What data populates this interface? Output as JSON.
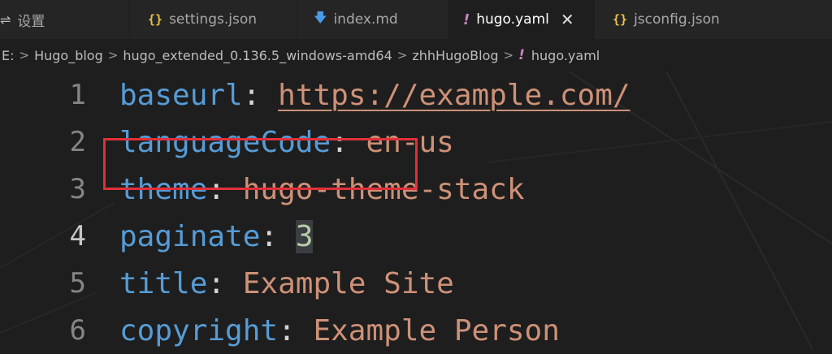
{
  "tabs": [
    {
      "label": "设置",
      "icon": "settings-icon"
    },
    {
      "label": "settings.json",
      "icon": "json-icon"
    },
    {
      "label": "index.md",
      "icon": "markdown-icon"
    },
    {
      "label": "hugo.yaml",
      "icon": "yaml-icon",
      "active": true,
      "close_glyph": "✕"
    },
    {
      "label": "jsconfig.json",
      "icon": "json-icon"
    }
  ],
  "icons": {
    "settings_glyph": "⇌",
    "json_glyph": "{}",
    "markdown_glyph": "🡇",
    "yaml_glyph": "!"
  },
  "breadcrumb": [
    "E:",
    "Hugo_blog",
    "hugo_extended_0.136.5_windows-amd64",
    "zhhHugoBlog",
    "hugo.yaml"
  ],
  "breadcrumb_sep": ">",
  "editor": {
    "lines": [
      {
        "n": "1",
        "key": "baseurl",
        "colon": ":",
        "value": "https://example.com/"
      },
      {
        "n": "2",
        "key": "languageCode",
        "colon": ":",
        "value": "en-us"
      },
      {
        "n": "3",
        "key": "theme",
        "colon": ":",
        "value": "hugo-theme-stack"
      },
      {
        "n": "4",
        "key": "paginate",
        "colon": ":",
        "value": "3"
      },
      {
        "n": "5",
        "key": "title",
        "colon": ":",
        "value": "Example Site"
      },
      {
        "n": "6",
        "key": "copyright",
        "colon": ":",
        "value": "Example Person"
      }
    ],
    "current_line": "4"
  },
  "colors": {
    "key": "#569cd6",
    "string": "#ce9178",
    "number": "#b5cea8",
    "highlight_box": "#e0303a"
  }
}
